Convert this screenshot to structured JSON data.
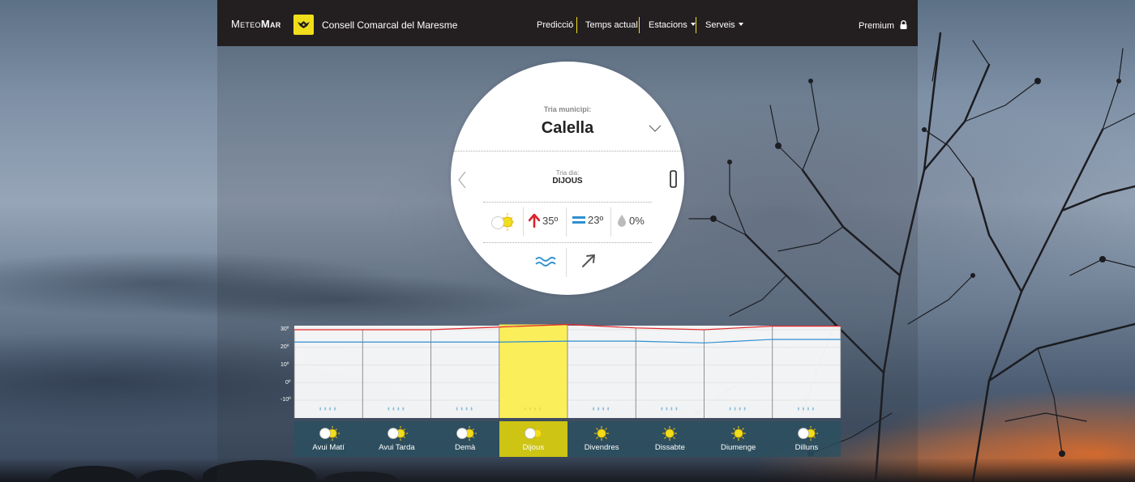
{
  "brand": {
    "logo_light": "Meteo",
    "logo_bold": "Mar",
    "council": "Consell Comarcal del Maresme"
  },
  "nav": {
    "items": [
      {
        "label": "Predicció",
        "dropdown": false
      },
      {
        "label": "Temps actual",
        "dropdown": false
      },
      {
        "label": "Estacions",
        "dropdown": true
      },
      {
        "label": "Serveis",
        "dropdown": true
      }
    ],
    "premium": "Premium"
  },
  "selector": {
    "municipi_label": "Tria municipi:",
    "municipi": "Calella",
    "dia_label": "Tria dia:",
    "dia": "DIJOUS"
  },
  "stats": {
    "max_temp": "35º",
    "avg_temp": "23º",
    "rain": "0%"
  },
  "chart_data": {
    "type": "line",
    "y_ticks": [
      "30º",
      "20º",
      "10º",
      "0º",
      "-10º"
    ],
    "ylim": [
      -10,
      30
    ],
    "categories": [
      "Avui Matí",
      "Avui Tarda",
      "Demà",
      "Dijous",
      "Divendres",
      "Dissabte",
      "Diumenge",
      "Dilluns"
    ],
    "series": [
      {
        "values": [
          30,
          30,
          30,
          31.5,
          33,
          31,
          30,
          32
        ]
      },
      {
        "values": [
          23,
          23,
          23,
          23,
          23.5,
          23.5,
          22.5,
          24.5
        ]
      }
    ],
    "highlight_index": 3,
    "colors": {
      "max": "#e2262b",
      "min": "#2e8fd0",
      "highlight": "#fbed4a"
    }
  },
  "days": [
    {
      "label": "Avui Matí",
      "icon": "partly-sunny-icon"
    },
    {
      "label": "Avui Tarda",
      "icon": "partly-sunny-icon"
    },
    {
      "label": "Demà",
      "icon": "partly-sunny-icon"
    },
    {
      "label": "Dijous",
      "icon": "partly-sunny-icon",
      "active": true
    },
    {
      "label": "Divendres",
      "icon": "sun-icon"
    },
    {
      "label": "Dissabte",
      "icon": "sun-icon"
    },
    {
      "label": "Diumenge",
      "icon": "sun-icon"
    },
    {
      "label": "Dilluns",
      "icon": "partly-sunny-icon"
    }
  ],
  "colors": {
    "accent": "#f1de1b",
    "navbar": "#231f20",
    "active_day": "#cdc414",
    "strip": "#2a5060"
  }
}
